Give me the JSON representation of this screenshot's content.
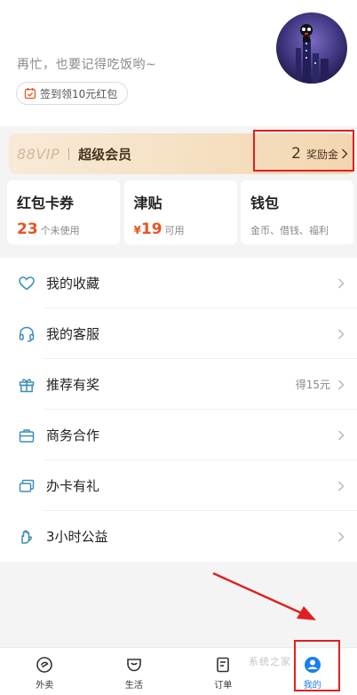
{
  "profile": {
    "greeting": "再忙，也要记得吃饭哟~",
    "signin_label": "签到领10元红包"
  },
  "vip": {
    "logo": "88VIP",
    "title": "超级会员",
    "bonus_count": "2",
    "bonus_label": "奖励金"
  },
  "cards": [
    {
      "title": "红包卡券",
      "num": "23",
      "sub": "个未使用"
    },
    {
      "title": "津贴",
      "prefix": "¥",
      "num": "19",
      "sub": "可用"
    },
    {
      "title": "钱包",
      "sub": "金币、借钱、福利"
    }
  ],
  "menu": [
    {
      "label": "我的收藏",
      "icon": "heart-icon"
    },
    {
      "label": "我的客服",
      "icon": "headset-icon"
    },
    {
      "label": "推荐有奖",
      "icon": "gift-icon",
      "extra": "得15元"
    },
    {
      "label": "商务合作",
      "icon": "briefcase-icon"
    },
    {
      "label": "办卡有礼",
      "icon": "card-icon"
    },
    {
      "label": "3小时公益",
      "icon": "hand-icon"
    }
  ],
  "tabs": [
    {
      "label": "外卖",
      "icon": "takeout-icon"
    },
    {
      "label": "生活",
      "icon": "life-icon"
    },
    {
      "label": "订单",
      "icon": "order-icon"
    },
    {
      "label": "我的",
      "icon": "profile-icon",
      "active": true
    }
  ],
  "watermark": "系统之家",
  "colors": {
    "accent_orange": "#e9531f",
    "accent_blue": "#1a7ff0",
    "annotation_red": "#e02020",
    "icon_teal": "#3a8fb7"
  }
}
